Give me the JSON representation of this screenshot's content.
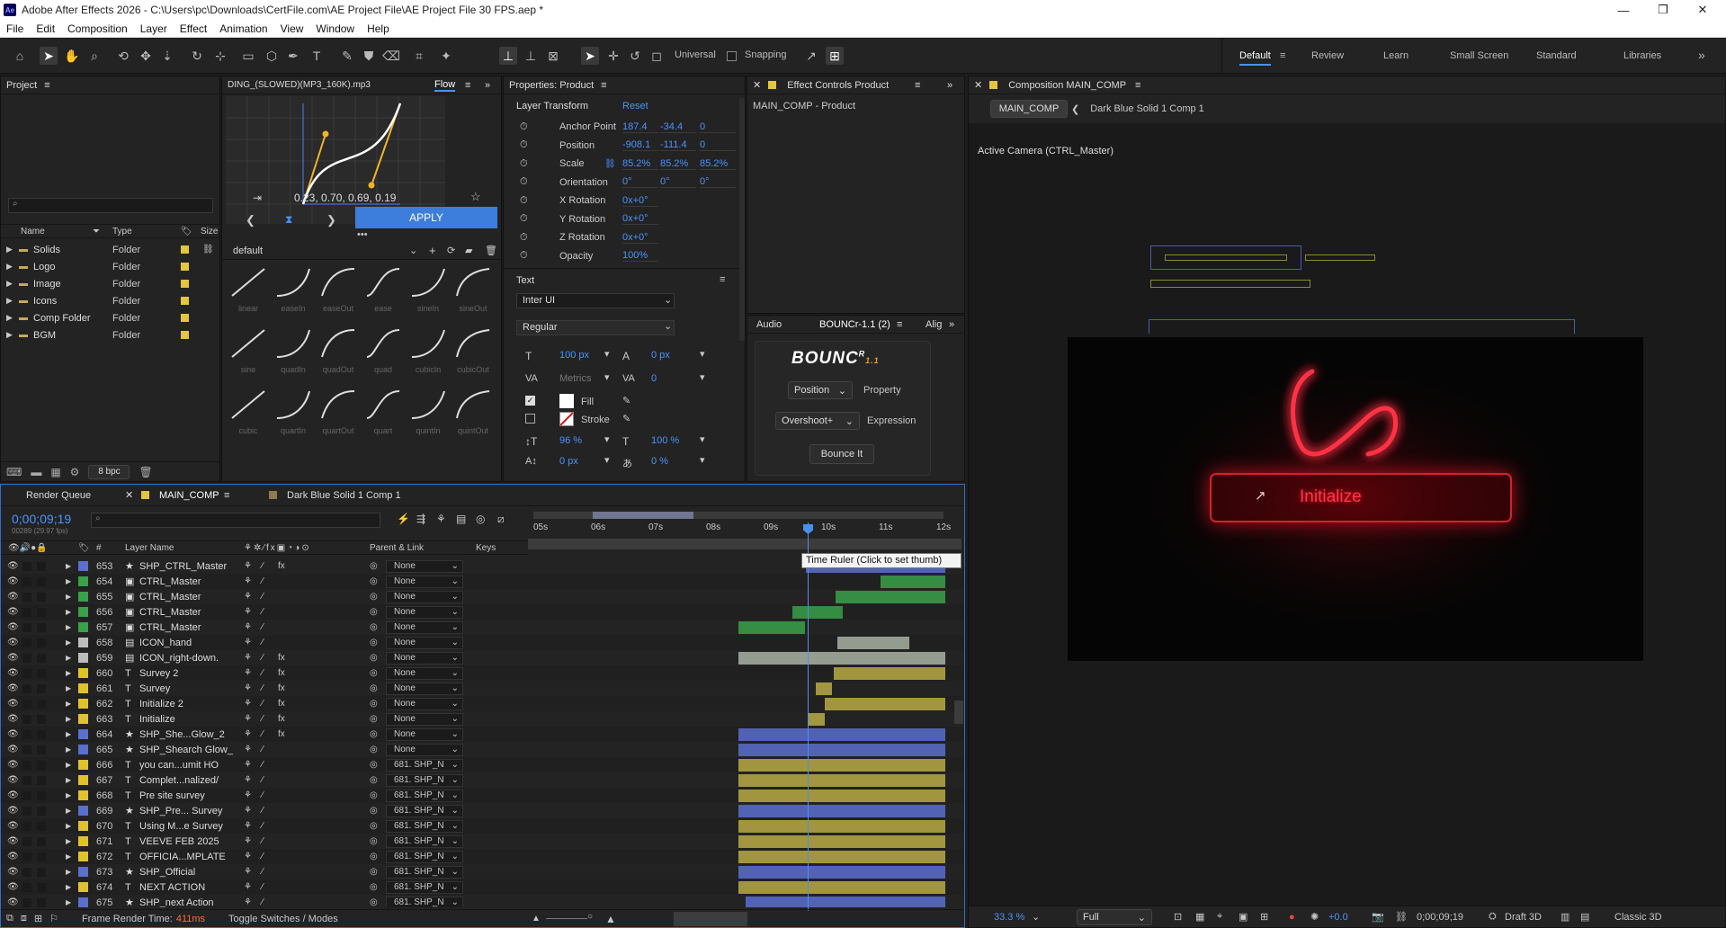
{
  "window": {
    "title": "Adobe After Effects 2026 - C:\\Users\\pc\\Downloads\\CertFile.com\\AE Project File\\AE Project File 30 FPS.aep *",
    "app_badge": "Ae"
  },
  "menu": [
    "File",
    "Edit",
    "Composition",
    "Layer",
    "Effect",
    "Animation",
    "View",
    "Window",
    "Help"
  ],
  "toolbar": {
    "universal": "Universal",
    "snapping": "Snapping"
  },
  "workspaces": [
    "Default",
    "Review",
    "Learn",
    "Small Screen",
    "Standard",
    "Libraries"
  ],
  "project": {
    "title": "Project",
    "columns": [
      "Name",
      "Type",
      "Size"
    ],
    "items": [
      {
        "name": "Solids",
        "type": "Folder"
      },
      {
        "name": "Logo",
        "type": "Folder"
      },
      {
        "name": "Image",
        "type": "Folder"
      },
      {
        "name": "Icons",
        "type": "Folder"
      },
      {
        "name": "Comp Folder",
        "type": "Folder"
      },
      {
        "name": "BGM",
        "type": "Folder"
      }
    ],
    "bpc": "8 bpc"
  },
  "flow": {
    "tab_file": "DING_(SLOWED)(MP3_160K).mp3",
    "tab_flow": "Flow",
    "curve_values": "0.23, 0.70, 0.69, 0.19",
    "apply": "APPLY",
    "preset_set": "default",
    "presets_row1": [
      "linear",
      "easeIn",
      "easeOut",
      "ease",
      "sineIn",
      "sineOut"
    ],
    "presets_row2": [
      "sine",
      "quadIn",
      "quadOut",
      "quad",
      "cubicIn",
      "cubicOut"
    ],
    "presets_row3": [
      "cubic",
      "quartIn",
      "quartOut",
      "quart",
      "quintIn",
      "quintOut"
    ]
  },
  "properties": {
    "title": "Properties: Product",
    "section": "Layer Transform",
    "reset": "Reset",
    "rows": [
      {
        "label": "Anchor Point",
        "v1": "187.4",
        "v2": "-34.4",
        "v3": "0"
      },
      {
        "label": "Position",
        "v1": "-908.1",
        "v2": "-111.4",
        "v3": "0"
      },
      {
        "label": "Scale",
        "v1": "85.2%",
        "v2": "85.2%",
        "v3": "85.2%"
      },
      {
        "label": "Orientation",
        "v1": "0°",
        "v2": "0°",
        "v3": "0°"
      },
      {
        "label": "X Rotation",
        "v1": "0x+0°",
        "v2": "",
        "v3": ""
      },
      {
        "label": "Y Rotation",
        "v1": "0x+0°",
        "v2": "",
        "v3": ""
      },
      {
        "label": "Z Rotation",
        "v1": "0x+0°",
        "v2": "",
        "v3": ""
      },
      {
        "label": "Opacity",
        "v1": "100%",
        "v2": "",
        "v3": ""
      }
    ],
    "text_section": "Text",
    "font": "Inter UI",
    "style": "Regular",
    "font_size": "100 px",
    "tracking": "0 px",
    "kerning": "Metrics",
    "kern_val": "0",
    "fill": "Fill",
    "stroke": "Stroke",
    "vscale": "96 %",
    "hscale": "100 %",
    "baseline": "0 px",
    "tsume": "0 %"
  },
  "effect_controls": {
    "title": "Effect Controls Product",
    "subtitle": "MAIN_COMP - Product"
  },
  "bounce_panel": {
    "tabs": [
      "Audio",
      "BOUNCr-1.1 (2)",
      "Alig"
    ],
    "logo": "BOUNC",
    "logo_sup": "R",
    "logo_ver": "1.1",
    "property_select": "Position",
    "property_label": "Property",
    "expression_select": "Overshoot+",
    "expression_label": "Expression",
    "button": "Bounce It"
  },
  "composition": {
    "title": "Composition MAIN_COMP",
    "breadcrumb_active": "MAIN_COMP",
    "breadcrumb_other": "Dark Blue Solid 1 Comp 1",
    "camera": "Active Camera (CTRL_Master)",
    "button_text": "Initialize",
    "zoom": "33.3 %",
    "resolution": "Full",
    "exposure": "+0.0",
    "timecode": "0;00;09;19",
    "renderer": "Draft 3D",
    "mode": "Classic 3D"
  },
  "timeline": {
    "tabs": [
      "Render Queue",
      "MAIN_COMP",
      "Dark Blue Solid 1 Comp 1"
    ],
    "timecode": "0;00;09;19",
    "frames": "00289 (29.97 fps)",
    "col_layer": "Layer Name",
    "col_parent": "Parent & Link",
    "col_keys": "Keys",
    "col_num": "#",
    "ruler": [
      "05s",
      "06s",
      "07s",
      "08s",
      "09s",
      "10s",
      "11s",
      "12s"
    ],
    "tooltip": "Time Ruler (Click to set thumb)",
    "status_label": "Frame Render Time:",
    "status_value": "411ms",
    "toggle": "Toggle Switches / Modes",
    "layers": [
      {
        "num": "653",
        "icon": "★",
        "name": "SHP_CTRL_Master",
        "color": "#5b6fcf",
        "parent": "None",
        "fx": true
      },
      {
        "num": "654",
        "icon": "▣",
        "name": "CTRL_Master",
        "color": "#3aa04a",
        "parent": "None",
        "fx": false
      },
      {
        "num": "655",
        "icon": "▣",
        "name": "CTRL_Master",
        "color": "#3aa04a",
        "parent": "None",
        "fx": false
      },
      {
        "num": "656",
        "icon": "▣",
        "name": "CTRL_Master",
        "color": "#3aa04a",
        "parent": "None",
        "fx": false
      },
      {
        "num": "657",
        "icon": "▣",
        "name": "CTRL_Master",
        "color": "#3aa04a",
        "parent": "None",
        "fx": false
      },
      {
        "num": "658",
        "icon": "▤",
        "name": "ICON_hand",
        "color": "#bdbdbd",
        "parent": "None",
        "fx": false
      },
      {
        "num": "659",
        "icon": "▤",
        "name": "ICON_right-down.",
        "color": "#bdbdbd",
        "parent": "None",
        "fx": true
      },
      {
        "num": "660",
        "icon": "T",
        "name": "Survey 2",
        "color": "#e0c22f",
        "parent": "None",
        "fx": true
      },
      {
        "num": "661",
        "icon": "T",
        "name": "Survey",
        "color": "#e0c22f",
        "parent": "None",
        "fx": true
      },
      {
        "num": "662",
        "icon": "T",
        "name": "Initialize 2",
        "color": "#e0c22f",
        "parent": "None",
        "fx": true
      },
      {
        "num": "663",
        "icon": "T",
        "name": "Initialize",
        "color": "#e0c22f",
        "parent": "None",
        "fx": true
      },
      {
        "num": "664",
        "icon": "★",
        "name": "SHP_She...Glow_2",
        "color": "#5b6fcf",
        "parent": "None",
        "fx": true
      },
      {
        "num": "665",
        "icon": "★",
        "name": "SHP_Shearch Glow_",
        "color": "#5b6fcf",
        "parent": "None",
        "fx": false
      },
      {
        "num": "666",
        "icon": "T",
        "name": "you can...umit HO",
        "color": "#e0c22f",
        "parent": "681. SHP_N",
        "fx": false
      },
      {
        "num": "667",
        "icon": "T",
        "name": "Complet...nalized/",
        "color": "#e0c22f",
        "parent": "681. SHP_N",
        "fx": false
      },
      {
        "num": "668",
        "icon": "T",
        "name": "Pre site survey",
        "color": "#e0c22f",
        "parent": "681. SHP_N",
        "fx": false
      },
      {
        "num": "669",
        "icon": "★",
        "name": "SHP_Pre... Survey",
        "color": "#5b6fcf",
        "parent": "681. SHP_N",
        "fx": false
      },
      {
        "num": "670",
        "icon": "T",
        "name": "Using M...e Survey",
        "color": "#e0c22f",
        "parent": "681. SHP_N",
        "fx": false
      },
      {
        "num": "671",
        "icon": "T",
        "name": "VEEVE FEB 2025",
        "color": "#e0c22f",
        "parent": "681. SHP_N",
        "fx": false
      },
      {
        "num": "672",
        "icon": "T",
        "name": "OFFICIA...MPLATE",
        "color": "#e0c22f",
        "parent": "681. SHP_N",
        "fx": false
      },
      {
        "num": "673",
        "icon": "★",
        "name": "SHP_Official",
        "color": "#5b6fcf",
        "parent": "681. SHP_N",
        "fx": false
      },
      {
        "num": "674",
        "icon": "T",
        "name": "NEXT ACTION",
        "color": "#e0c22f",
        "parent": "681. SHP_N",
        "fx": false
      },
      {
        "num": "675",
        "icon": "★",
        "name": "SHP_next Action",
        "color": "#5b6fcf",
        "parent": "681. SHP_N",
        "fx": false
      }
    ]
  }
}
